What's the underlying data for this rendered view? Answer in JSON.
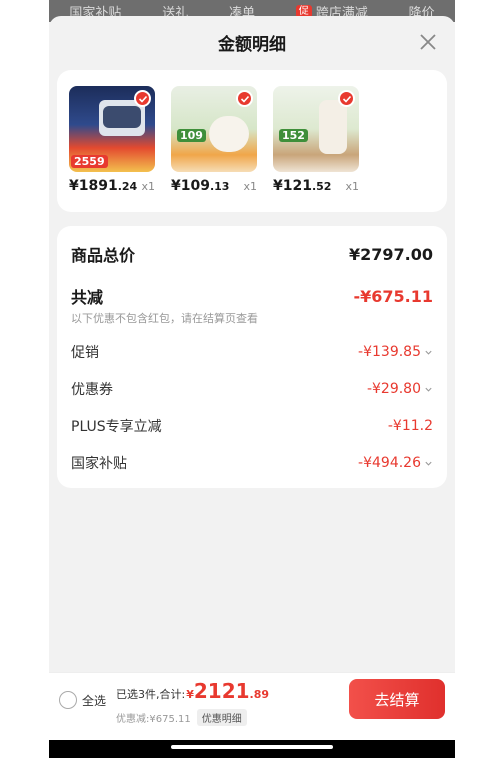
{
  "top_tabs": [
    {
      "label": "国家补贴"
    },
    {
      "label": "送礼"
    },
    {
      "label": "凑单"
    },
    {
      "label": "跨店满减",
      "badge": "促"
    },
    {
      "label": "降价"
    }
  ],
  "sheet": {
    "title": "金额明细",
    "close_icon": "close-icon"
  },
  "products": [
    {
      "price_int": "¥1891",
      "price_dec": ".24",
      "qty": "x1",
      "thumb_label": "2559",
      "checked": true
    },
    {
      "price_int": "¥109",
      "price_dec": ".13",
      "qty": "x1",
      "thumb_label": "109",
      "checked": true
    },
    {
      "price_int": "¥121",
      "price_dec": ".52",
      "qty": "x1",
      "thumb_label": "152",
      "checked": true
    }
  ],
  "summary": {
    "total_label": "商品总价",
    "total_value": "¥2797.00",
    "reduce_label": "共减",
    "reduce_value": "-¥675.11",
    "note": "以下优惠不包含红包，请在结算页查看",
    "items": [
      {
        "label": "促销",
        "value": "-¥139.85",
        "expandable": true
      },
      {
        "label": "优惠券",
        "value": "-¥29.80",
        "expandable": true
      },
      {
        "label": "PLUS专享立减",
        "value": "-¥11.2",
        "expandable": false
      },
      {
        "label": "国家补贴",
        "value": "-¥494.26",
        "expandable": true
      }
    ]
  },
  "bottom_bar": {
    "select_all_label": "全选",
    "selected_text": "已选3件,合计:",
    "total_prefix": "¥",
    "total_int": "2121",
    "total_dec": ".89",
    "reduced_text": "优惠减:¥675.11",
    "detail_chip": "优惠明细",
    "checkout_label": "去结算"
  },
  "colors": {
    "accent": "#e8392f",
    "background": "#f2f2f2",
    "card": "#ffffff"
  }
}
